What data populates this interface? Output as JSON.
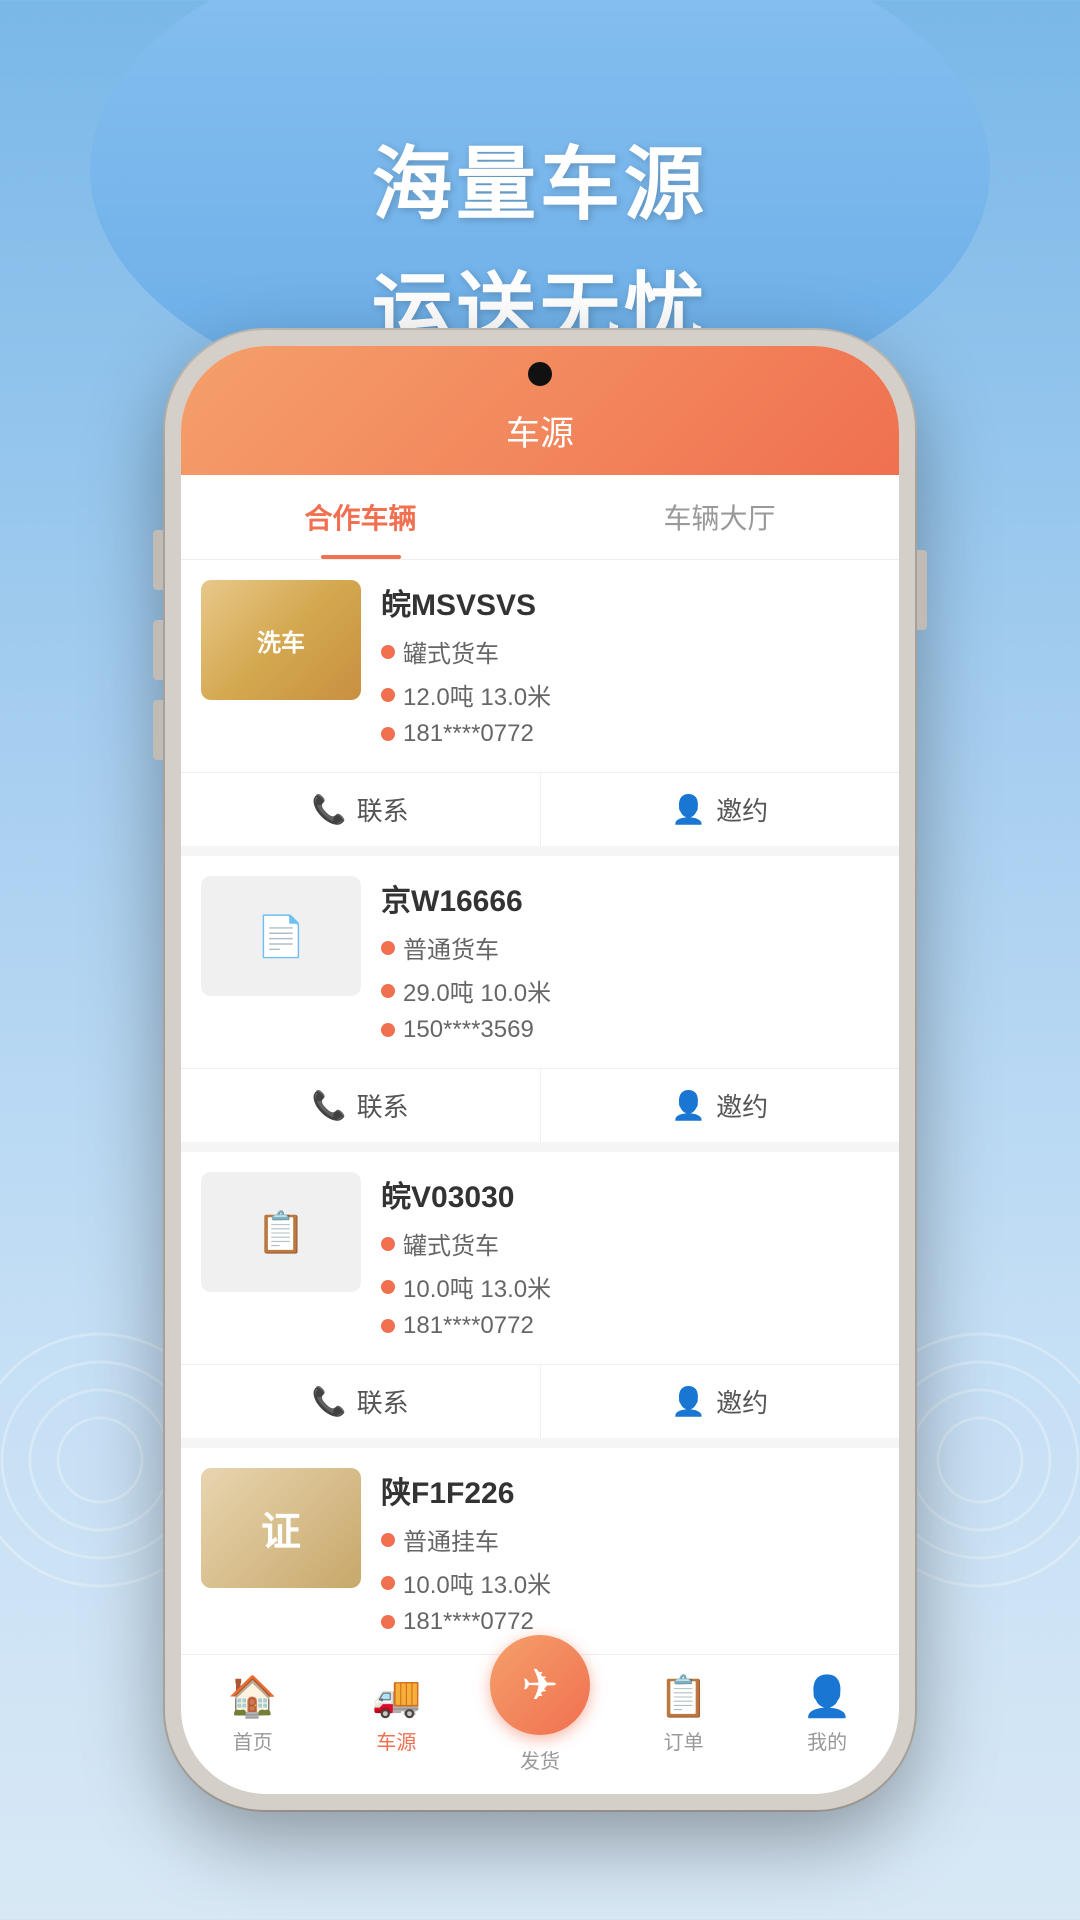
{
  "hero": {
    "line1": "海量车源",
    "line2": "运送无忧"
  },
  "app": {
    "title": "车源"
  },
  "tabs": [
    {
      "id": "cooperation",
      "label": "合作车辆",
      "active": true
    },
    {
      "id": "hall",
      "label": "车辆大厅",
      "active": false
    }
  ],
  "vehicles": [
    {
      "id": 1,
      "plate": "皖MSVSVS",
      "type": "罐式货车",
      "weight": "12.0吨",
      "length": "13.0米",
      "phone": "181****0772",
      "img_type": "carwash"
    },
    {
      "id": 2,
      "plate": "京W16666",
      "type": "普通货车",
      "weight": "29.0吨",
      "length": "10.0米",
      "phone": "150****3569",
      "img_type": "doc"
    },
    {
      "id": 3,
      "plate": "皖V03030",
      "type": "罐式货车",
      "weight": "10.0吨",
      "length": "13.0米",
      "phone": "181****0772",
      "img_type": "doc2"
    },
    {
      "id": 4,
      "plate": "陕F1F226",
      "type": "普通挂车",
      "weight": "10.0吨",
      "length": "13.0米",
      "phone": "181****0772",
      "img_type": "license"
    }
  ],
  "actions": {
    "contact": "联系",
    "invite": "邀约"
  },
  "nav": [
    {
      "id": "home",
      "label": "首页",
      "icon": "🏠",
      "active": false
    },
    {
      "id": "vehicles",
      "label": "车源",
      "icon": "🚛",
      "active": true
    },
    {
      "id": "ship",
      "label": "发货",
      "icon": "✈",
      "active": false,
      "is_fab": true
    },
    {
      "id": "orders",
      "label": "订单",
      "icon": "📋",
      "active": false
    },
    {
      "id": "mine",
      "label": "我的",
      "icon": "👤",
      "active": false
    }
  ]
}
